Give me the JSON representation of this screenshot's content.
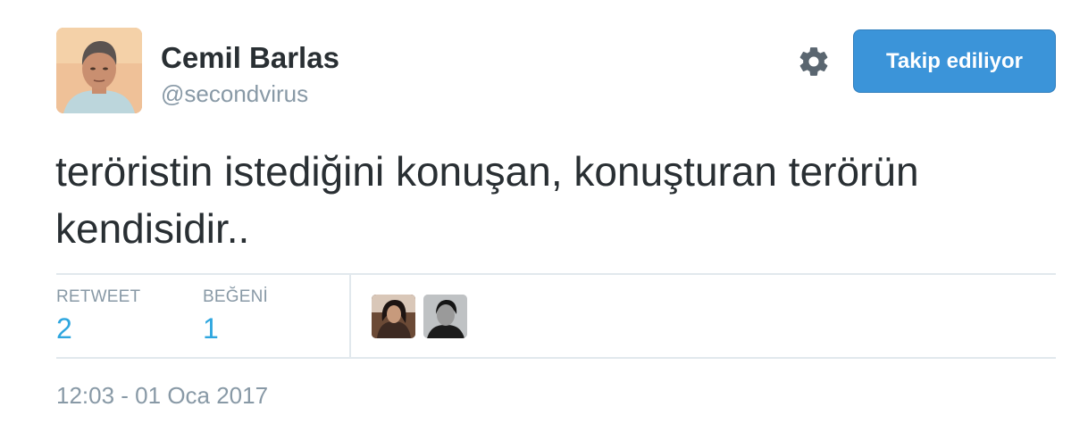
{
  "author": {
    "name": "Cemil Barlas",
    "handle": "@secondvirus"
  },
  "actions": {
    "follow_label": "Takip ediliyor",
    "settings_icon": "gear-icon"
  },
  "tweet": {
    "text": "teröristin istediğini konuşan, konuşturan terörün kendisidir..",
    "timestamp": "12:03 - 01 Oca 2017"
  },
  "stats": {
    "retweet_label": "RETWEET",
    "retweet_count": "2",
    "like_label": "BEĞENİ",
    "like_count": "1"
  },
  "colors": {
    "accent": "#2ea6df",
    "button": "#3b94d9",
    "muted": "#8899a6",
    "text": "#292f33",
    "divider": "#e1e8ed"
  }
}
